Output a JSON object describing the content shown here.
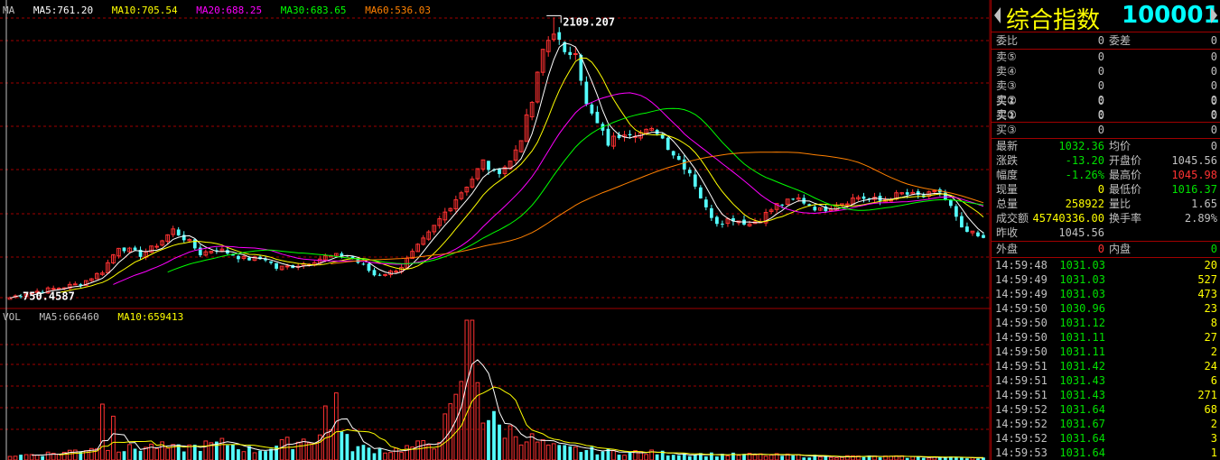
{
  "main_legend": {
    "ma_label": "MA",
    "ma5": "MA5:761.20",
    "ma10": "MA10:705.54",
    "ma20": "MA20:688.25",
    "ma30": "MA30:683.65",
    "ma60": "MA60:536.03"
  },
  "vol_legend": {
    "vol_label": "VOL",
    "ma5": "MA5:666460",
    "ma10": "MA10:659413"
  },
  "colors": {
    "ma5": "#ffffff",
    "ma10": "#ffff00",
    "ma20": "#ff00ff",
    "ma30": "#00ff00",
    "ma60": "#ff8000",
    "up": "#ff3232",
    "down": "#54ffff",
    "grid": "#a00000",
    "price_up": "#ff3232",
    "price_down": "#00e000"
  },
  "chart_data": [
    {
      "type": "candlestick",
      "title": "",
      "annotations": {
        "high": "2109.207",
        "low": "750.4587"
      },
      "ylim": [
        700,
        2150
      ],
      "x_count": 180,
      "ma_periods": [
        5,
        10,
        20,
        30,
        60
      ],
      "close_path": [
        [
          0,
          752
        ],
        [
          3,
          775
        ],
        [
          8,
          795
        ],
        [
          13,
          820
        ],
        [
          17,
          880
        ],
        [
          20,
          1000
        ],
        [
          24,
          960
        ],
        [
          26,
          990
        ],
        [
          28,
          1030
        ],
        [
          30,
          1080
        ],
        [
          33,
          1020
        ],
        [
          35,
          965
        ],
        [
          38,
          990
        ],
        [
          43,
          940
        ],
        [
          47,
          940
        ],
        [
          49,
          895
        ],
        [
          52,
          905
        ],
        [
          55,
          925
        ],
        [
          58,
          950
        ],
        [
          62,
          958
        ],
        [
          65,
          905
        ],
        [
          67,
          862
        ],
        [
          70,
          875
        ],
        [
          72,
          905
        ],
        [
          77,
          1060
        ],
        [
          81,
          1200
        ],
        [
          85,
          1330
        ],
        [
          87,
          1410
        ],
        [
          89,
          1350
        ],
        [
          92,
          1410
        ],
        [
          94,
          1530
        ],
        [
          96,
          1700
        ],
        [
          98,
          1950
        ],
        [
          100,
          2050
        ],
        [
          102,
          1920
        ],
        [
          104,
          1960
        ],
        [
          106,
          1680
        ],
        [
          110,
          1500
        ],
        [
          113,
          1560
        ],
        [
          116,
          1550
        ],
        [
          119,
          1560
        ],
        [
          122,
          1450
        ],
        [
          125,
          1360
        ],
        [
          128,
          1180
        ],
        [
          130,
          1120
        ],
        [
          133,
          1135
        ],
        [
          136,
          1110
        ],
        [
          138,
          1135
        ],
        [
          141,
          1200
        ],
        [
          145,
          1230
        ],
        [
          149,
          1175
        ],
        [
          152,
          1205
        ],
        [
          156,
          1240
        ],
        [
          160,
          1220
        ],
        [
          164,
          1255
        ],
        [
          168,
          1240
        ],
        [
          171,
          1265
        ],
        [
          173,
          1190
        ],
        [
          175,
          1080
        ],
        [
          177,
          1060
        ],
        [
          179,
          1032
        ]
      ],
      "spikes": {
        "100": 2109.207,
        "0": 750.4587
      }
    },
    {
      "type": "bar",
      "title": "",
      "series": [
        {
          "values": "derived per candle"
        }
      ],
      "ylim": [
        0,
        1500000
      ],
      "volume_path": [
        [
          0,
          45000
        ],
        [
          10,
          80000
        ],
        [
          17,
          160000
        ],
        [
          20,
          110000
        ],
        [
          27,
          150000
        ],
        [
          30,
          120000
        ],
        [
          40,
          180000
        ],
        [
          45,
          100000
        ],
        [
          55,
          230000
        ],
        [
          60,
          340000
        ],
        [
          63,
          140000
        ],
        [
          70,
          100000
        ],
        [
          78,
          180000
        ],
        [
          82,
          560000
        ],
        [
          84,
          1300000
        ],
        [
          86,
          560000
        ],
        [
          90,
          350000
        ],
        [
          100,
          130000
        ],
        [
          110,
          90000
        ],
        [
          130,
          60000
        ],
        [
          150,
          40000
        ],
        [
          179,
          25000
        ]
      ],
      "big_bars": {
        "17": 600000,
        "19": 470000,
        "58": 580000,
        "60": 720000,
        "84": 1500000,
        "85": 1500000,
        "86": 830000
      }
    }
  ],
  "right_panel": {
    "title": "综合指数",
    "code": "100001",
    "weibi_label": "委比",
    "weibi_val": "0",
    "weicha_label": "委差",
    "weicha_val": "0",
    "sell": [
      {
        "label": "卖⑤",
        "price": "0",
        "vol": "0"
      },
      {
        "label": "卖④",
        "price": "0",
        "vol": "0"
      },
      {
        "label": "卖③",
        "price": "0",
        "vol": "0"
      },
      {
        "label": "卖②",
        "price": "0",
        "vol": "0"
      },
      {
        "label": "卖①",
        "price": "0",
        "vol": "0"
      }
    ],
    "buy": [
      {
        "label": "买①",
        "price": "0",
        "vol": "0"
      },
      {
        "label": "买②",
        "price": "0",
        "vol": "0"
      },
      {
        "label": "买③",
        "price": "0",
        "vol": "0"
      }
    ],
    "quote": [
      {
        "l1": "最新",
        "v1": "1032.36",
        "c1": "#00e000",
        "l2": "均价",
        "v2": "0",
        "c2": "#c0c0c0"
      },
      {
        "l1": "涨跌",
        "v1": "-13.20",
        "c1": "#00e000",
        "l2": "开盘价",
        "v2": "1045.56",
        "c2": "#c0c0c0"
      },
      {
        "l1": "幅度",
        "v1": "-1.26%",
        "c1": "#00e000",
        "l2": "最高价",
        "v2": "1045.98",
        "c2": "#ff3232"
      },
      {
        "l1": "现量",
        "v1": "0",
        "c1": "#ffff00",
        "l2": "最低价",
        "v2": "1016.37",
        "c2": "#00e000"
      },
      {
        "l1": "总量",
        "v1": "258922",
        "c1": "#ffff00",
        "l2": "量比",
        "v2": "1.65",
        "c2": "#c0c0c0"
      },
      {
        "l1": "成交额",
        "v1": "45740336.00",
        "c1": "#ffff00",
        "l2": "换手率",
        "v2": "2.89%",
        "c2": "#c0c0c0"
      },
      {
        "l1": "昨收",
        "v1": "1045.56",
        "c1": "#c0c0c0",
        "l2": "",
        "v2": "",
        "c2": "#c0c0c0"
      }
    ],
    "waipan_label": "外盘",
    "waipan_val": "0",
    "neipan_label": "内盘",
    "neipan_val": "0",
    "ticks": [
      {
        "time": "14:59:48",
        "price": "1031.03",
        "vol": "20"
      },
      {
        "time": "14:59:49",
        "price": "1031.03",
        "vol": "527"
      },
      {
        "time": "14:59:49",
        "price": "1031.03",
        "vol": "473"
      },
      {
        "time": "14:59:50",
        "price": "1030.96",
        "vol": "23"
      },
      {
        "time": "14:59:50",
        "price": "1031.12",
        "vol": "8"
      },
      {
        "time": "14:59:50",
        "price": "1031.11",
        "vol": "27"
      },
      {
        "time": "14:59:50",
        "price": "1031.11",
        "vol": "2"
      },
      {
        "time": "14:59:51",
        "price": "1031.42",
        "vol": "24"
      },
      {
        "time": "14:59:51",
        "price": "1031.43",
        "vol": "6"
      },
      {
        "time": "14:59:51",
        "price": "1031.43",
        "vol": "271"
      },
      {
        "time": "14:59:52",
        "price": "1031.64",
        "vol": "68"
      },
      {
        "time": "14:59:52",
        "price": "1031.67",
        "vol": "2"
      },
      {
        "time": "14:59:52",
        "price": "1031.64",
        "vol": "3"
      },
      {
        "time": "14:59:53",
        "price": "1031.64",
        "vol": "1"
      }
    ]
  }
}
